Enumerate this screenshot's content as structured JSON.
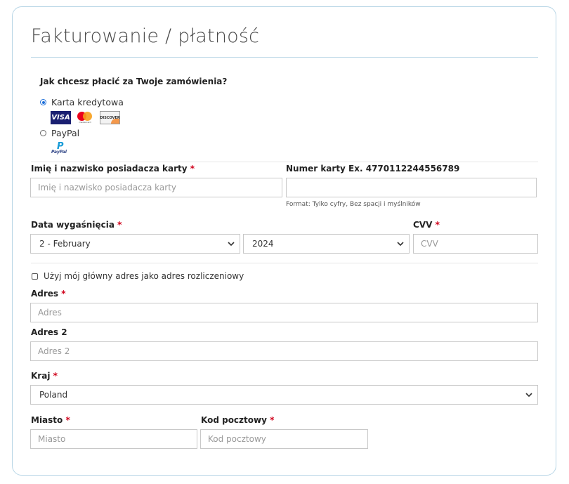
{
  "form": {
    "title": "Fakturowanie / płatność",
    "payment_question": "Jak chcesz płacić za Twoje zamówienia?",
    "payment_methods": [
      {
        "label": "Karta kredytowa",
        "selected": true
      },
      {
        "label": "PayPal",
        "selected": false
      }
    ],
    "card_logos": {
      "visa": "VISA",
      "mastercard": "mastercard",
      "discover": "DISCOVER",
      "paypal": "PayPal"
    },
    "required_marker": "*",
    "cardholder": {
      "label": "Imię i nazwisko posiadacza karty",
      "placeholder": "Imię i nazwisko posiadacza karty",
      "value": ""
    },
    "card_number": {
      "label": "Numer karty Ex. 4770112244556789",
      "value": "",
      "hint": "Format: Tylko cyfry, Bez spacji i myślników"
    },
    "expiry": {
      "label": "Data wygaśnięcia",
      "month": "2 - February",
      "year": "2024"
    },
    "cvv": {
      "label": "CVV",
      "placeholder": "CVV",
      "value": ""
    },
    "use_main_address": {
      "label": "Użyj mój główny adres jako adres rozliczeniowy",
      "checked": false
    },
    "address": {
      "label": "Adres",
      "placeholder": "Adres",
      "value": ""
    },
    "address2": {
      "label": "Adres 2",
      "placeholder": "Adres 2",
      "value": ""
    },
    "country": {
      "label": "Kraj",
      "value": "Poland"
    },
    "city": {
      "label": "Miasto",
      "placeholder": "Miasto",
      "value": ""
    },
    "postal_code": {
      "label": "Kod pocztowy",
      "placeholder": "Kod pocztowy",
      "value": ""
    }
  },
  "colors": {
    "accent": "#1e6fd9",
    "border": "#b8d6e6",
    "required": "#d0021b",
    "visa": "#1a1f71"
  }
}
